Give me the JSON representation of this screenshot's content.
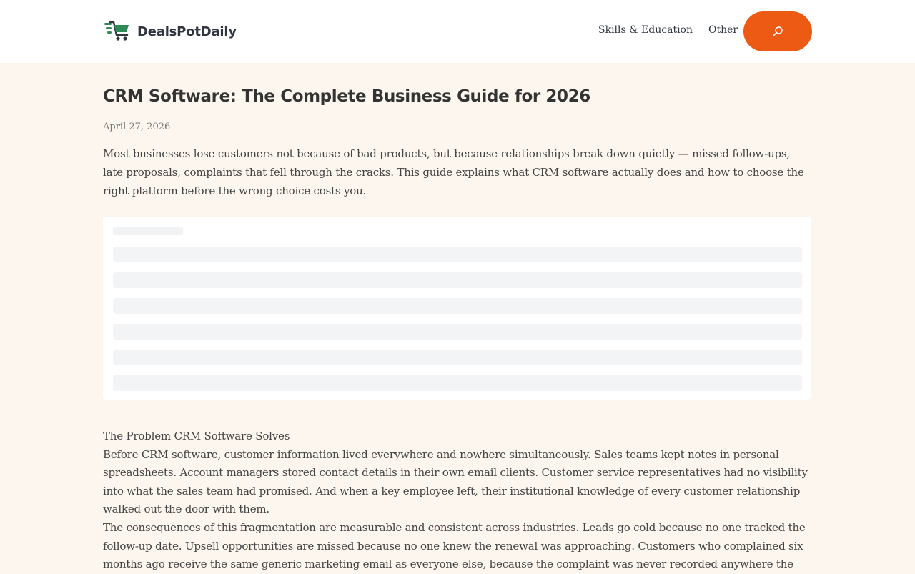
{
  "site": {
    "name": "DealsPotDaily"
  },
  "nav": {
    "items": [
      {
        "label": "Skills & Education"
      },
      {
        "label": "Other"
      }
    ]
  },
  "search": {
    "icon": "search-icon",
    "color": "#ec5a13"
  },
  "article": {
    "title": "CRM Software: The Complete Business Guide for 2026",
    "date": "April 27, 2026",
    "intro": "Most businesses lose customers not because of bad products, but because relationships break down quietly — missed follow-ups, late proposals, complaints that fell through the cracks. This guide explains what CRM software actually does and how to choose the right platform before the wrong choice costs you.",
    "section_heading": "The Problem CRM Software Solves",
    "paragraphs": [
      "Before CRM software, customer information lived everywhere and nowhere simultaneously. Sales teams kept notes in personal spreadsheets. Account managers stored contact details in their own email clients. Customer service representatives had no visibility into what the sales team had promised. And when a key employee left, their institutional knowledge of every customer relationship walked out the door with them.",
      "The consequences of this fragmentation are measurable and consistent across industries. Leads go cold because no one tracked the follow-up date. Upsell opportunities are missed because no one knew the renewal was approaching. Customers who complained six months ago receive the same generic marketing email as everyone else, because the complaint was never recorded anywhere the"
    ]
  },
  "colors": {
    "accent": "#ec5a13",
    "page_background": "#fdf6ee",
    "logo_green": "#2e8b57"
  }
}
